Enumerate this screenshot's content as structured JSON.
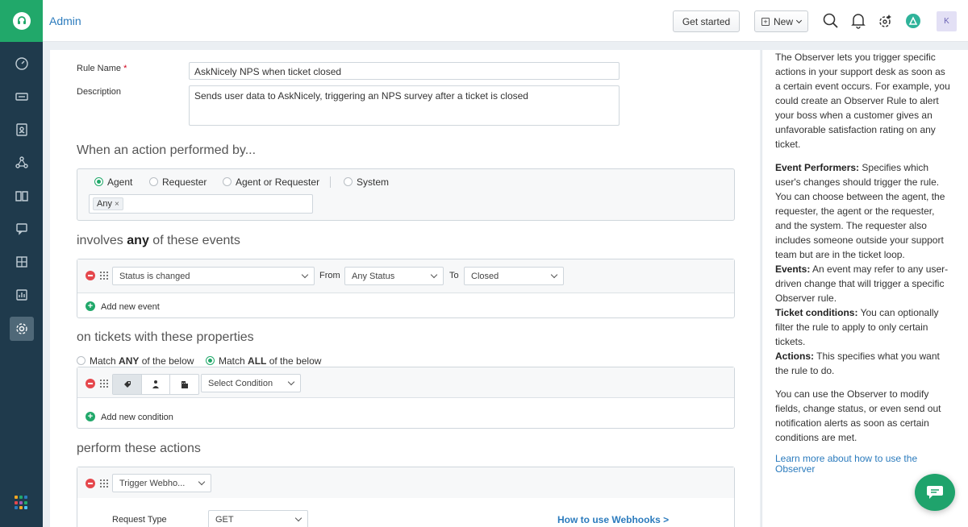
{
  "header": {
    "title": "Admin",
    "get_started": "Get started",
    "new_label": "New",
    "avatar_initial": "K"
  },
  "rule": {
    "name_label": "Rule Name",
    "required_mark": "*",
    "name_value": "AskNicely NPS when ticket closed",
    "description_label": "Description",
    "description_value": "Sends user data to AskNicely, triggering an NPS survey after a ticket is closed"
  },
  "performer": {
    "heading": "When an action performed by...",
    "options": [
      "Agent",
      "Requester",
      "Agent or Requester",
      "System"
    ],
    "selected": "Agent",
    "tag": "Any",
    "tag_remove": "×"
  },
  "events": {
    "heading_pre": "involves",
    "heading_bold": "any",
    "heading_post": "of these events",
    "event_field": "Status is changed",
    "from_label": "From",
    "from_value": "Any Status",
    "to_label": "To",
    "to_value": "Closed",
    "add_label": "Add new event"
  },
  "conditions": {
    "heading": "on tickets with these properties",
    "match_any_pre": "Match",
    "match_any_bold": "ANY",
    "match_any_post": "of the below",
    "match_all_pre": "Match",
    "match_all_bold": "ALL",
    "match_all_post": "of the below",
    "selected_match": "ALL",
    "select_placeholder": "Select Condition",
    "add_label": "Add new condition"
  },
  "actions": {
    "heading": "perform these actions",
    "action_value": "Trigger Webho...",
    "request_type_label": "Request Type",
    "request_type_value": "GET",
    "webhooks_link": "How to use Webhooks >"
  },
  "help": {
    "intro": "The Observer lets you trigger specific actions in your support desk as soon as a certain event occurs. For example, you could create an Observer Rule to alert your boss when a customer gives an unfavorable satisfaction rating on any ticket.",
    "performers_title": "Event Performers:",
    "performers_text": "Specifies which user's changes should trigger the rule. You can choose between the agent, the requester, the agent or the requester, and the system. The requester also includes someone outside your support team but are in the ticket loop.",
    "events_title": "Events:",
    "events_text": "An event may refer to any user-driven change that will trigger a specific Observer rule.",
    "conditions_title": "Ticket conditions:",
    "conditions_text": "You can optionally filter the rule to apply to only certain tickets.",
    "actions_title": "Actions:",
    "actions_text": "This specifies what you want the rule to do.",
    "outro": "You can use the Observer to modify fields, change status, or even send out notification alerts as soon as certain conditions are met.",
    "learn_more": "Learn more about how to use the Observer"
  },
  "colors": {
    "brand_green": "#21a86a",
    "rail": "#1f3a4c",
    "link": "#2b7bbd",
    "danger": "#e5484d"
  }
}
